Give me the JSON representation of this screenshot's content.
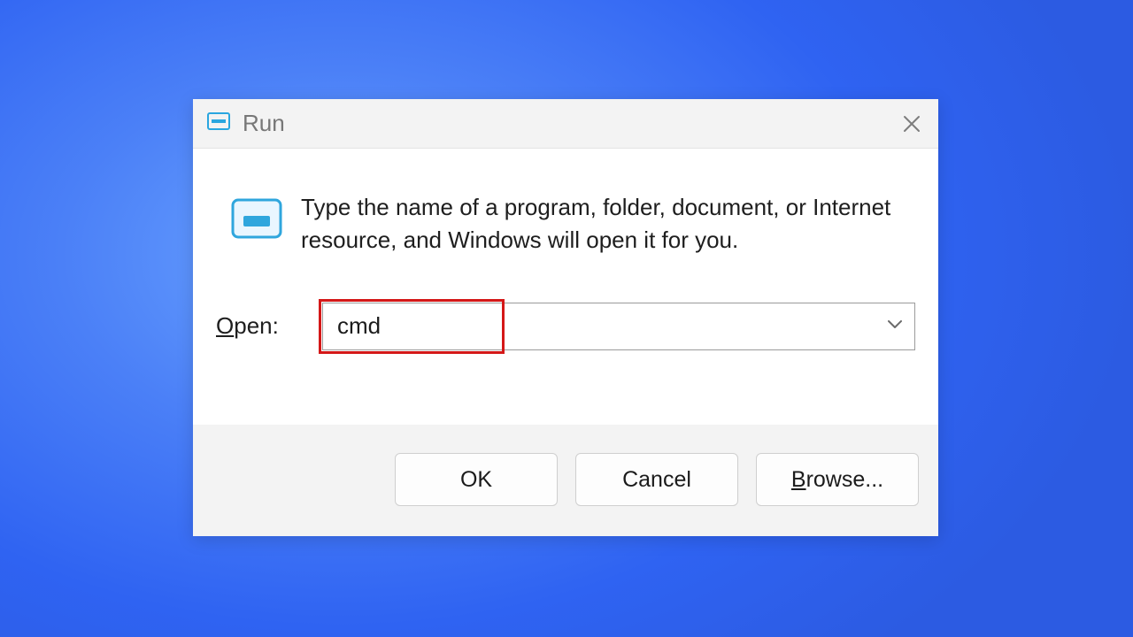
{
  "dialog": {
    "title": "Run",
    "description": "Type the name of a program, folder, document, or Internet resource, and Windows will open it for you.",
    "open_label_uchar": "O",
    "open_label_rest": "pen:",
    "input_value": "cmd",
    "buttons": {
      "ok": "OK",
      "cancel": "Cancel",
      "browse_uchar": "B",
      "browse_rest": "rowse..."
    },
    "colors": {
      "highlight": "#d41818",
      "accent_icon": "#2aa6df"
    }
  }
}
